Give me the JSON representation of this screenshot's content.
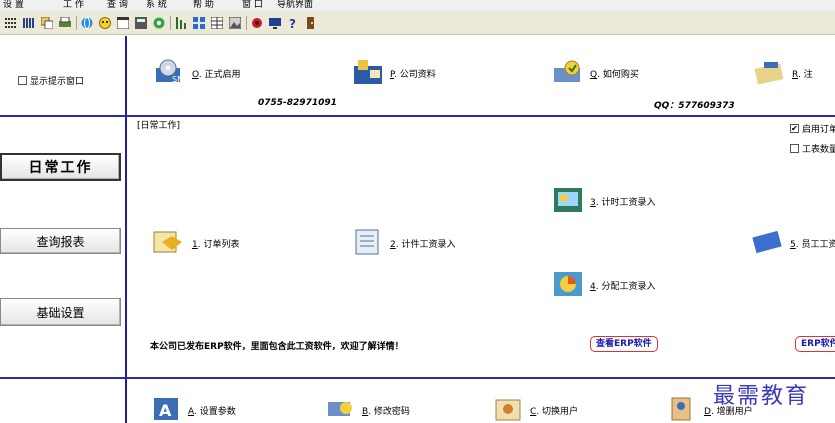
{
  "menu": [
    {
      "label": "设 置",
      "name": "menu-settings"
    },
    {
      "label": "工 作",
      "name": "menu-work"
    },
    {
      "label": "查 询",
      "name": "menu-query"
    },
    {
      "label": "系 统",
      "name": "menu-system"
    },
    {
      "label": "帮 助",
      "name": "menu-help"
    },
    {
      "label": "窗 口",
      "name": "menu-window"
    },
    {
      "label": "导航界面",
      "name": "menu-navigation"
    }
  ],
  "left": {
    "show_tip_window": {
      "label": "显示提示窗口",
      "checked": false
    },
    "nav": [
      {
        "label": "日常工作",
        "active": true
      },
      {
        "label": "查询报表",
        "active": false
      },
      {
        "label": "基础设置",
        "active": false
      }
    ]
  },
  "top_actions": [
    {
      "key": "O",
      "label": ". 正式启用",
      "icon": "cd-icon"
    },
    {
      "key": "P",
      "label": ". 公司资料",
      "icon": "company-icon"
    },
    {
      "key": "Q",
      "label": ". 如何购买",
      "icon": "purchase-icon"
    },
    {
      "key": "R",
      "label": ". 注",
      "icon": "register-icon"
    }
  ],
  "contact": {
    "phone": "0755-82971091",
    "qq": "QQ：577609373"
  },
  "daily": {
    "section_label": "[日常工作]",
    "options": [
      {
        "label": "启用订单",
        "checked": true
      },
      {
        "label": "工表数量",
        "checked": false
      }
    ],
    "actions": [
      {
        "key": "1",
        "label": ". 订单列表",
        "icon": "order-list-icon"
      },
      {
        "key": "2",
        "label": ". 计件工资录入",
        "icon": "piece-wage-icon"
      },
      {
        "key": "3",
        "label": ". 计时工资录入",
        "icon": "time-wage-icon"
      },
      {
        "key": "4",
        "label": ". 分配工资录入",
        "icon": "allocate-wage-icon"
      },
      {
        "key": "5",
        "label": ". 员工工资",
        "icon": "employee-wage-icon"
      }
    ],
    "notice": "本公司已发布ERP软件，里面包含此工资软件，欢迎了解详情！",
    "erp_button": "查看ERP软件",
    "erp_button_2": "ERP软件"
  },
  "bottom_actions": [
    {
      "key": "A",
      "label": ". 设置参数",
      "icon": "settings-param-icon"
    },
    {
      "key": "B",
      "label": ". 修改密码",
      "icon": "password-icon"
    },
    {
      "key": "C",
      "label": ". 切换用户",
      "icon": "switch-user-icon"
    },
    {
      "key": "D",
      "label": ". 增删用户",
      "icon": "manage-user-icon"
    }
  ],
  "watermark": "最需教育",
  "colors": {
    "frame": "#1f1fa0",
    "accent_red": "#dd3333",
    "watermark": "#3a3ab8"
  }
}
